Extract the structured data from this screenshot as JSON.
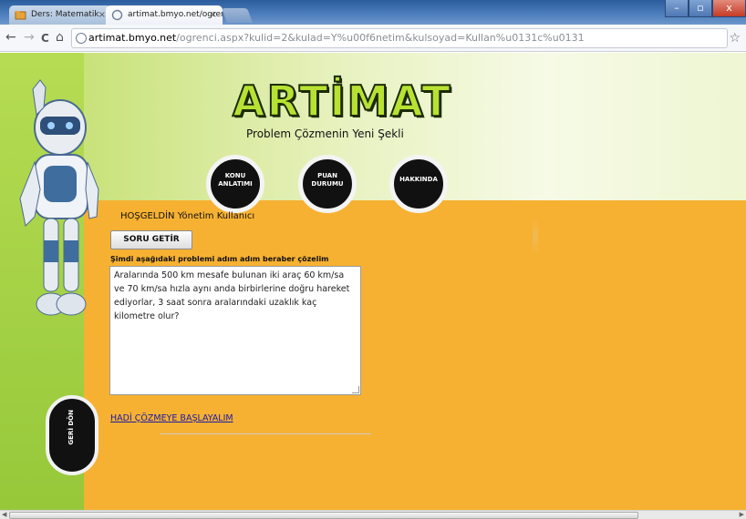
{
  "browser": {
    "tabs": [
      {
        "label": "Ders: Matematik",
        "active": false
      },
      {
        "label": "artimat.bmyo.net/ogrenci.a",
        "active": true
      }
    ],
    "address_host": "artimat.bmyo.net",
    "address_path": "/ogrenci.aspx?kulid=2&kulad=Y%u00f6netim&kulsoyad=Kullan%u0131c%u0131",
    "back_glyph": "←",
    "forward_glyph": "→",
    "reload_glyph": "C",
    "home_glyph": "⌂",
    "star_glyph": "☆",
    "window_controls": {
      "minimize": "–",
      "maximize": "▫",
      "close": "x"
    }
  },
  "site": {
    "logo_text": "ARTİMAT",
    "slogan": "Problem Çözmenin Yeni Şekli",
    "nav": [
      {
        "label_line1": "KONU",
        "label_line2": "ANLATIMI"
      },
      {
        "label_line1": "PUAN",
        "label_line2": "DURUMU"
      },
      {
        "label_line1": "HAKKINDA",
        "label_line2": ""
      }
    ],
    "back_button": "GERİ DÖN"
  },
  "main": {
    "welcome_prefix": "HOŞGELDİN",
    "welcome_user": "Yönetim Kullanıcı",
    "get_question_button": "SORU GETİR",
    "instruction": "Şimdi aşağıdaki problemi adım adım beraber çözelim",
    "question_text": "Aralarında 500 km mesafe bulunan iki araç 60 km/sa ve 70 km/sa hızla aynı anda birbirlerine doğru hareket ediyorlar, 3 saat sonra aralarındaki uzaklık kaç kilometre olur?",
    "start_link": "HADİ ÇÖZMEYE BAŞLAYALIM"
  },
  "colors": {
    "leftbar": "#a5d146",
    "content": "#f7b132",
    "logo": "#b7e233",
    "link": "#1a1aa6"
  },
  "icons": {
    "robot": "robot-mascot-icon",
    "page_globe": "globe-icon",
    "tab_favicon_1": "folder-favicon-icon",
    "tab_favicon_2": "page-favicon-icon"
  }
}
